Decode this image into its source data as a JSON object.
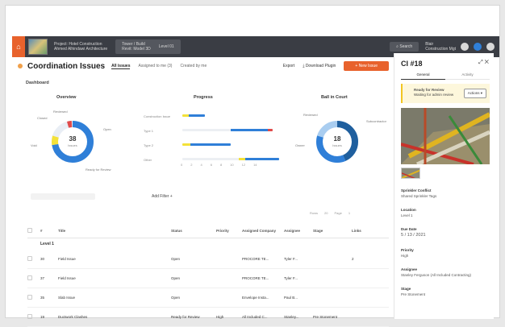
{
  "topbar": {
    "home_icon": "home-icon",
    "breadcrumb": [
      "Project: Hotel Construction",
      "Ahmed Alhindawi Architecture",
      "Tower / Build",
      "Revit: Model 3D",
      "Level 01"
    ],
    "search_label": "Search",
    "user_line1": "Blair",
    "user_line2": "Construction Mgt"
  },
  "header": {
    "title": "Coordination Issues",
    "tabs": [
      "All issues",
      "Assigned to me (3)",
      "Created by me"
    ],
    "export_label": "Export",
    "download_label": "Download Plugin",
    "new_issue_label": "+ New Issue"
  },
  "dashboard": {
    "label": "Dashboard",
    "overview": {
      "title": "Overview",
      "center_value": "38",
      "center_sub": "Issues",
      "labels": [
        "Reviewed",
        "Open",
        "Void",
        "Closed",
        "Ready for Review"
      ]
    },
    "progress": {
      "title": "Progress",
      "rows": [
        "Construction Issue",
        "Type 1",
        "Type 2",
        "Other"
      ],
      "axis": [
        "0",
        "2",
        "4",
        "6",
        "8",
        "10",
        "12",
        "14"
      ]
    },
    "ball_in_court": {
      "title": "Ball in Court",
      "center_value": "18",
      "center_sub": "Issues",
      "labels": [
        "Reviewed",
        "Subcontractor",
        "Owner"
      ]
    }
  },
  "filters": {
    "add_filter": "Add Filter +",
    "pager": [
      "Rows",
      "20",
      "Page",
      "1"
    ]
  },
  "table": {
    "columns": [
      "#",
      "Title",
      "Status",
      "Priority",
      "Assigned Company",
      "Assignee",
      "Stage",
      "Links"
    ],
    "group": "Level 1",
    "rows": [
      {
        "id": "30",
        "title": "Field Issue",
        "status": "Open",
        "priority": "",
        "company": "PROCORE TE...",
        "assignee": "Tyler F...",
        "stage": "",
        "links": "2"
      },
      {
        "id": "37",
        "title": "Field Issue",
        "status": "Open",
        "priority": "",
        "company": "PROCORE TE...",
        "assignee": "Tyler F...",
        "stage": "",
        "links": ""
      },
      {
        "id": "35",
        "title": "Slab Issue",
        "status": "Open",
        "priority": "",
        "company": "Envelope Insta...",
        "assignee": "Paul B...",
        "stage": "",
        "links": ""
      },
      {
        "id": "19",
        "title": "Ductwork Clashes",
        "status": "Ready for Review",
        "priority": "High",
        "company": "All Included C...",
        "assignee": "Stanley...",
        "stage": "Pre Stonement",
        "links": ""
      }
    ]
  },
  "sidepanel": {
    "title": "CI #18",
    "tabs": [
      "General",
      "Activity"
    ],
    "status_title": "Ready for Review",
    "status_sub": "Waiting for admin review",
    "action_label": "Actions",
    "fields": [
      {
        "label": "Sprinkler Conflict",
        "value": "Shared Sprinkler Tags"
      },
      {
        "label": "Location",
        "value": "Level 1"
      },
      {
        "label": "Due Date",
        "value": "5 / 13 / 2021"
      },
      {
        "label": "Priority",
        "value": "High"
      },
      {
        "label": "Assignee",
        "value": "Stanley Ferguson (All Included Contracting)"
      },
      {
        "label": "Stage",
        "value": "Pre Stonement"
      }
    ]
  },
  "colors": {
    "accent": "#e8622c",
    "topbar": "#3a3d44",
    "blue": "#2f7fd8",
    "yellow": "#f3e13a",
    "red": "#e04a4a"
  }
}
